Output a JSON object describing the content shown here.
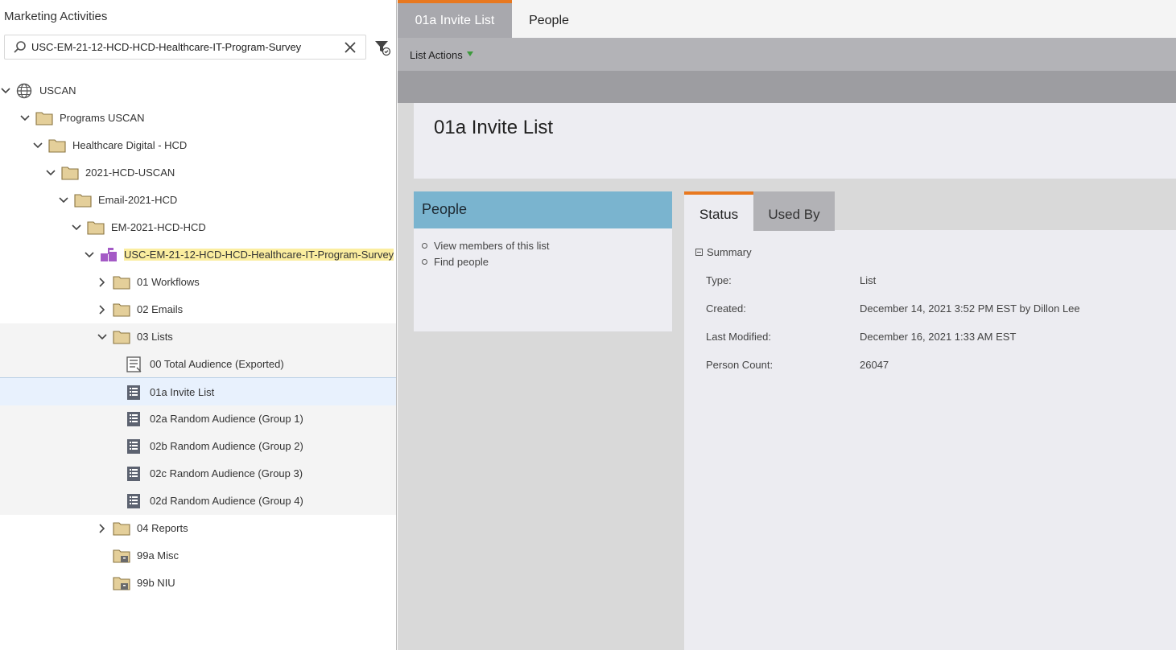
{
  "left_panel": {
    "title": "Marketing Activities",
    "search_value": "USC-EM-21-12-HCD-HCD-Healthcare-IT-Program-Survey",
    "tree": [
      {
        "label": "USCAN",
        "icon": "globe-icon",
        "chevron": "down"
      },
      {
        "label": "Programs USCAN",
        "icon": "folder-icon",
        "chevron": "down"
      },
      {
        "label": "Healthcare Digital - HCD",
        "icon": "folder-icon",
        "chevron": "down"
      },
      {
        "label": "2021-HCD-USCAN",
        "icon": "folder-icon",
        "chevron": "down"
      },
      {
        "label": "Email-2021-HCD",
        "icon": "folder-icon",
        "chevron": "down"
      },
      {
        "label": "EM-2021-HCD-HCD",
        "icon": "folder-icon",
        "chevron": "down"
      },
      {
        "label": "USC-EM-21-12-HCD-HCD-Healthcare-IT-Program-Survey",
        "icon": "email-program-icon",
        "chevron": "down"
      },
      {
        "label": "01 Workflows",
        "icon": "folder-icon",
        "chevron": "right"
      },
      {
        "label": "02 Emails",
        "icon": "folder-icon",
        "chevron": "right"
      },
      {
        "label": "03 Lists",
        "icon": "folder-icon",
        "chevron": "down"
      },
      {
        "label": "00 Total Audience (Exported)",
        "icon": "list-outline-icon",
        "chevron": ""
      },
      {
        "label": "01a Invite List",
        "icon": "list-icon",
        "chevron": ""
      },
      {
        "label": "02a Random Audience (Group 1)",
        "icon": "list-icon",
        "chevron": ""
      },
      {
        "label": "02b Random Audience (Group 2)",
        "icon": "list-icon",
        "chevron": ""
      },
      {
        "label": "02c Random Audience (Group 3)",
        "icon": "list-icon",
        "chevron": ""
      },
      {
        "label": "02d Random Audience (Group 4)",
        "icon": "list-icon",
        "chevron": ""
      },
      {
        "label": "04 Reports",
        "icon": "folder-icon",
        "chevron": "right"
      },
      {
        "label": "99a Misc",
        "icon": "archive-folder-icon",
        "chevron": ""
      },
      {
        "label": "99b NIU",
        "icon": "archive-folder-icon",
        "chevron": ""
      }
    ]
  },
  "right_panel": {
    "tabs": [
      "01a Invite List",
      "People"
    ],
    "toolbar": {
      "list_actions": "List Actions"
    },
    "header_title": "01a Invite List",
    "people_box": {
      "title": "People",
      "links": [
        "View members of this list",
        "Find people"
      ]
    },
    "detail_tabs": [
      "Status",
      "Used By"
    ],
    "summary_label": "Summary",
    "fields": [
      {
        "key": "Type:",
        "value": "List"
      },
      {
        "key": "Created:",
        "value": "December 14, 2021 3:52 PM EST by Dillon Lee"
      },
      {
        "key": "Last Modified:",
        "value": "December 16, 2021 1:33 AM EST"
      },
      {
        "key": "Person Count:",
        "value": "26047"
      }
    ]
  },
  "colors": {
    "accent_orange": "#e8781f",
    "people_header": "#7ab4cf",
    "highlight": "#fbed9f",
    "selection": "#e8f1fd"
  }
}
